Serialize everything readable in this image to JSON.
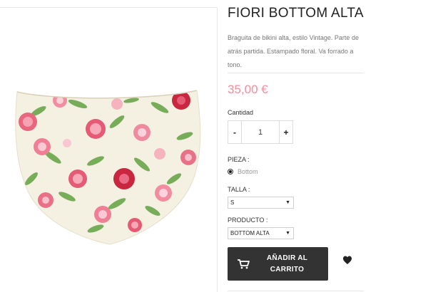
{
  "product": {
    "title": "FIORI BOTTOM ALTA",
    "description": "Braguita de bikini alta, estilo Vintage. Parte de atrás partida. Estampado floral.  Va forrado a tono.",
    "price": "35,00 €",
    "price_color": "#f28e9c"
  },
  "quantity": {
    "label": "Cantidad",
    "minus": "-",
    "value": "1",
    "plus": "+"
  },
  "pieza": {
    "label": "PIEZA :",
    "option": "Bottom"
  },
  "talla": {
    "label": "TALLA :",
    "selected": "S"
  },
  "producto": {
    "label": "PRODUCTO :",
    "selected": "BOTTOM ALTA"
  },
  "cart": {
    "label_line1": "AÑADIR AL",
    "label_line2": "CARRITO",
    "icon": "cart-icon",
    "button_color": "#333333"
  },
  "wishlist": {
    "icon": "heart-icon"
  }
}
